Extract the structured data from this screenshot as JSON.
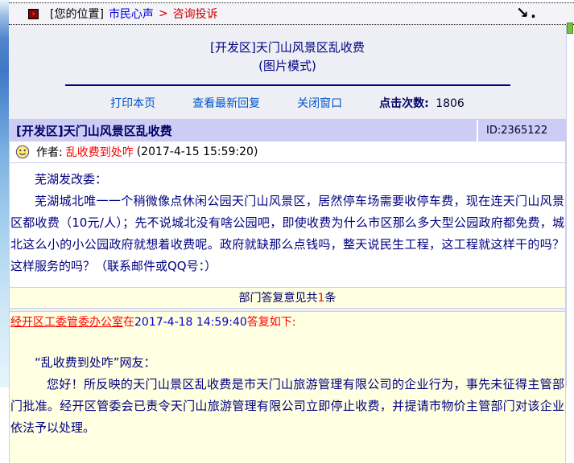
{
  "colors": {
    "navy_text": "#000080",
    "red_text": "#ff0000",
    "link_blue": "#0055cc",
    "lavender_border": "#ccccf0",
    "header_lavender": "#ccccf5",
    "reply_yellow": "#ffffe1",
    "page_gray": "#edeff4"
  },
  "breadcrumb": {
    "marker": "›",
    "prefix": "[您的位置]",
    "site": "市民心声",
    "separator": ">",
    "section": "咨询投诉",
    "resize_arrow": "↘."
  },
  "title": {
    "line1": "[开发区]天门山风景区乱收费",
    "line2": "(图片模式)"
  },
  "toolbar": {
    "print_label": "打印本页",
    "latest_reply_label": "查看最新回复",
    "close_label": "关闭窗口",
    "hits_label": "点击次数:",
    "hits_value": "1806"
  },
  "post": {
    "header_title": "[开发区]天门山风景区乱收费",
    "id": "ID:2365122",
    "author_label": "作者:",
    "author_name": "乱收费到处咋",
    "post_time": "(2017-4-15 15:59:20)",
    "body": [
      "芜湖发改委：",
      "芜湖城北唯一一个稍微像点休闲公园天门山风景区，居然停车场需要收停车费，现在连天门山风景区都收费（10元/人）；先不说城北没有啥公园吧，即使收费为什么市区那么多大型公园政府都免费，城北这么小的小公园政府就想着收费呢。政府就缺那么点钱吗，整天说民生工程，这工程就这样干的吗？这样服务的吗？（联系邮件或QQ号：）"
    ]
  },
  "replies": {
    "summary_prefix": "部门答复意见共",
    "summary_count": "1",
    "summary_suffix": "条",
    "reply": {
      "department": "经开区工委管委办公室",
      "at_word": "在",
      "reply_time": "2017-4-18 14:59:40",
      "head_suffix": "答复如下:",
      "body": [
        "“乱收费到处咋”网友：",
        "您好！所反映的天门山景区乱收费是市天门山旅游管理有限公司的企业行为，事先未征得主管部门批准。经开区管委会已责令天门山旅游管理有限公司立即停止收费，并提请市物价主管部门对该企业依法予以处理。"
      ]
    }
  }
}
